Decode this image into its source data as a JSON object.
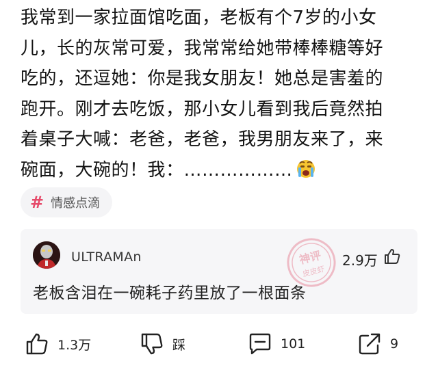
{
  "post": {
    "lines": [
      "我常到一家拉面馆吃面，老板有个7岁的小女",
      "儿，长的灰常可爱，我常常给她带棒棒糖等好",
      "吃的，还逗她：你是我女朋友！她总是害羞的",
      "跑开。刚才去吃饭，那小女儿看到我后竟然拍",
      "着桌子大喊：老爸，老爸，我男朋友来了，来",
      "碗面，大碗的！我：………………"
    ],
    "emoji": "crying-face-icon"
  },
  "topic": {
    "hash": "#",
    "label": "情感点滴"
  },
  "top_comment": {
    "username": "ULTRAMAn",
    "likes": "2.9万",
    "text": "老板含泪在一碗耗子药里放了一根面条",
    "stamp_line1": "神评",
    "stamp_line2": "皮皮虾"
  },
  "actions": {
    "like_count": "1.3万",
    "dislike_label": "踩",
    "comment_count": "101",
    "share_count": "9"
  },
  "colors": {
    "accent": "#e64a6a",
    "stamp": "#e0506a",
    "card_bg": "#f6f6f8"
  }
}
